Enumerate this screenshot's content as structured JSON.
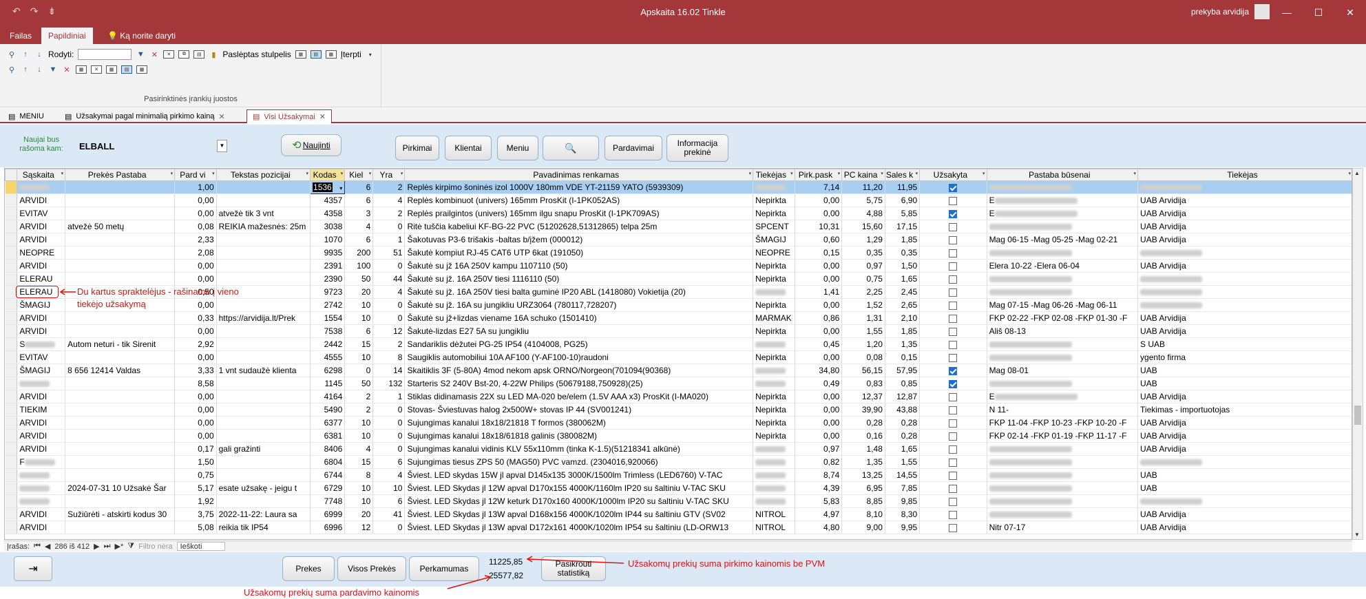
{
  "window": {
    "title": "Apskaita 16.02 Tinkle",
    "user": "prekyba arvidija",
    "controls": [
      "—",
      "☐",
      "✕"
    ]
  },
  "quick_access": [
    "↶",
    "↷",
    "⇟"
  ],
  "ribbon": {
    "tabs": [
      "Failas",
      "Papildiniai"
    ],
    "tell_me": "Ką norite daryti",
    "rodyti_label": "Rodyti:",
    "hidden_column_label": "Paslėptas stulpelis",
    "insert_label": "Įterpti",
    "group_label": "Pasirinktinės įrankių juostos"
  },
  "doc_tabs": [
    {
      "label": "MENIU"
    },
    {
      "label": "Užsakymai pagal minimalią pirkimo kainą"
    },
    {
      "label": "Visi Užsakymai"
    }
  ],
  "form": {
    "naujai_label": "Naujai bus rašoma kam:",
    "supplier": "ELBALL",
    "buttons": {
      "refresh": "Naujinti",
      "pirkimai": "Pirkimai",
      "klientai": "Klientai",
      "meniu": "Meniu",
      "pardavimai": "Pardavimai",
      "info_line1": "Informacija",
      "info_line2": "prekinė"
    }
  },
  "grid": {
    "columns": [
      "Sąskaita",
      "Prekės Pastaba",
      "Pard vi",
      "Tekstas pozicijai",
      "Kodas",
      "Kiel",
      "Yra",
      "Pavadinimas renkamas",
      "Tiekėjas",
      "Pirk.pask",
      "PC kaina",
      "Sales k",
      "Užsakyta",
      "Pastaba būsenai",
      "Tiekėjas"
    ],
    "rows": [
      [
        "",
        "",
        "1,00",
        "",
        "1536",
        "6",
        "2",
        "Replės kirpimo šoninės izol 1000V 180mm VDE YT-21159 YATO (5939309)",
        "",
        "7,14",
        "11,20",
        "11,95",
        true,
        "",
        ""
      ],
      [
        "ARVIDI",
        "",
        "0,00",
        "",
        "4357",
        "6",
        "4",
        "Replės kombinuot (univers) 165mm ProsKit (I-1PK052AS)",
        "Nepirkta",
        "0,00",
        "5,75",
        "6,90",
        false,
        "E",
        "UAB Arvidija"
      ],
      [
        "EVITAV",
        "",
        "0,00",
        "atvežė tik 3 vnt",
        "4358",
        "3",
        "2",
        "Replės prailgintos (univers) 165mm ilgu snapu ProsKit (I-1PK709AS)",
        "Nepirkta",
        "0,00",
        "4,88",
        "5,85",
        true,
        "E",
        "UAB Arvidija"
      ],
      [
        "ARVIDI",
        "atvežė 50 metų",
        "0,08",
        "REIKIA mažesnės: 25m",
        "3038",
        "4",
        "0",
        "Ritė tuščia kabeliui KF-BG-22 PVC (51202628,51312865) telpa 25m",
        "SPCENT",
        "10,31",
        "15,60",
        "17,15",
        false,
        "",
        "UAB Arvidija"
      ],
      [
        "ARVIDI",
        "",
        "2,33",
        "",
        "1070",
        "6",
        "1",
        "Šakotuvas P3-6 trišakis -baltas b/įžem (000012)",
        "ŠMAGIJ",
        "0,60",
        "1,29",
        "1,85",
        false,
        "Mag 06-15 -Mag 05-25 -Mag 02-21",
        "UAB Arvidija"
      ],
      [
        "NEOPRE",
        "",
        "2,08",
        "",
        "9935",
        "200",
        "51",
        "Šakutė kompiut  RJ-45 CAT6  UTP 6kat (191050)",
        "NEOPRE",
        "0,15",
        "0,35",
        "0,35",
        false,
        "",
        ""
      ],
      [
        "ARVIDI",
        "",
        "0,00",
        "",
        "2391",
        "100",
        "0",
        "Šakutė su jž 16A 250V kampu  1107110 (50)",
        "Nepirkta",
        "0,00",
        "0,97",
        "1,50",
        false,
        "Elera 10-22 -Elera 06-04",
        "UAB Arvidija"
      ],
      [
        "ELERAU",
        "",
        "0,00",
        "",
        "2390",
        "50",
        "44",
        "Šakutė su jž. 16A 250V tiesi  1116110 (50)",
        "Nepirkta",
        "0,00",
        "0,75",
        "1,65",
        false,
        "",
        ""
      ],
      [
        "ELERAU",
        "",
        "0,50",
        "",
        "9723",
        "20",
        "4",
        "Šakutė su jž. 16A 250V tiesi balta guminė IP20 ABL (1418080) Vokietija (20)",
        "",
        "1,41",
        "2,25",
        "2,45",
        false,
        "",
        ""
      ],
      [
        "ŠMAGIJ",
        "",
        "0,00",
        "",
        "2742",
        "10",
        "0",
        "Šakutė su jž. 16A su jungikliu URZ3064 (780117,728207)",
        "Nepirkta",
        "0,00",
        "1,52",
        "2,65",
        false,
        "Mag 07-15 -Mag 06-26 -Mag 06-11",
        ""
      ],
      [
        "ARVIDI",
        "",
        "0,33",
        "https://arvidija.lt/Prek",
        "1554",
        "10",
        "0",
        "Šakutė su jž+lizdas  viename 16A schuko (1501410)",
        "MARMAK",
        "0,86",
        "1,31",
        "2,10",
        false,
        "FKP 02-22 -FKP 02-08 -FKP 01-30 -F",
        "UAB Arvidija"
      ],
      [
        "ARVIDI",
        "",
        "0,00",
        "",
        "7538",
        "6",
        "12",
        "Šakutė-lizdas E27 5A su jungikliu",
        "Nepirkta",
        "0,00",
        "1,55",
        "1,85",
        false,
        "Ališ 08-13",
        "UAB Arvidija"
      ],
      [
        "S",
        "Autom neturi - tik Sirenit",
        "2,92",
        "",
        "2442",
        "15",
        "2",
        "Sandariklis dėžutei PG-25 IP54 (4104008, PG25)",
        "",
        "0,45",
        "1,20",
        "1,35",
        false,
        "",
        "S UAB"
      ],
      [
        "EVITAV",
        "",
        "0,00",
        "",
        "4555",
        "10",
        "8",
        "Saugiklis automobiliui 10A AF100 (Y-AF100-10)raudoni",
        "Nepirkta",
        "0,00",
        "0,08",
        "0,15",
        false,
        "",
        "ygento firma"
      ],
      [
        "ŠMAGIJ",
        "8 656 12414 Valdas",
        "3,33",
        "1 vnt sudaužė klienta",
        "6298",
        "0",
        "14",
        "Skaitiklis 3F (5-80A) 4mod nekom apsk ORNO/Norgeon(701094(90368)",
        "",
        "34,80",
        "56,15",
        "57,95",
        true,
        "Mag 08-01",
        "UAB"
      ],
      [
        "",
        "",
        "8,58",
        "",
        "1145",
        "50",
        "132",
        "Starteris S2 240V Bst-20, 4-22W Philips (50679188,750928)(25)",
        "",
        "0,49",
        "0,83",
        "0,85",
        true,
        "",
        "UAB"
      ],
      [
        "ARVIDI",
        "",
        "0,00",
        "",
        "4164",
        "2",
        "1",
        "Stiklas didinamasis 22X su LED MA-020 be/elem (1.5V AAA x3) ProsKit (I-MA020)",
        "Nepirkta",
        "0,00",
        "12,37",
        "12,87",
        false,
        "E",
        "UAB Arvidija"
      ],
      [
        "TIEKIM",
        "",
        "0,00",
        "",
        "5490",
        "2",
        "0",
        "Stovas- Šviestuvas halog 2x500W+ stovas IP 44 (SV001241)",
        "Nepirkta",
        "0,00",
        "39,90",
        "43,88",
        false,
        "N 11-",
        "Tiekimas - importuotojas"
      ],
      [
        "ARVIDI",
        "",
        "0,00",
        "",
        "6377",
        "10",
        "0",
        "Sujungimas kanalui 18x18/21818 T formos (380062M)",
        "Nepirkta",
        "0,00",
        "0,28",
        "0,28",
        false,
        "FKP 11-04 -FKP 10-23 -FKP 10-20 -F",
        "UAB Arvidija"
      ],
      [
        "ARVIDI",
        "",
        "0,00",
        "",
        "6381",
        "10",
        "0",
        "Sujungimas kanalui 18x18/61818 galinis (380082M)",
        "Nepirkta",
        "0,00",
        "0,16",
        "0,28",
        false,
        "FKP 02-14 -FKP 01-19 -FKP 11-17 -F",
        "UAB Arvidija"
      ],
      [
        "ARVIDI",
        "",
        "0,17",
        "gali gražinti",
        "8406",
        "4",
        "0",
        "Sujungimas kanalui vidinis KLV 55x110mm (tinka K-1.5)(51218341 alkūnė)",
        "",
        "0,97",
        "1,48",
        "1,65",
        false,
        "",
        "UAB Arvidija"
      ],
      [
        "F",
        "",
        "1,50",
        "",
        "6804",
        "15",
        "6",
        "Sujungimas tiesus ZPS 50 (MAG50) PVC vamzd. (2304016,920066)",
        "",
        "0,82",
        "1,35",
        "1,55",
        false,
        "",
        ""
      ],
      [
        "",
        "",
        "0,75",
        "",
        "6744",
        "8",
        "4",
        "Šviest. LED skydas 15W jl apval D145x135 3000K/1500lm Trimless (LED6760) V-TAC",
        "",
        "8,74",
        "13,25",
        "14,55",
        false,
        "",
        "UAB"
      ],
      [
        "",
        "2024-07-31 10 Užsakė Šar",
        "5,17",
        "esate užsakę - jeigu t",
        "6729",
        "10",
        "10",
        "Šviest. LED Skydas jl 12W apval D170x155 4000K/1160lm IP20 su šaltiniu V-TAC SKU",
        "",
        "4,39",
        "6,95",
        "7,85",
        false,
        "",
        "UAB"
      ],
      [
        "",
        "",
        "1,92",
        "",
        "7748",
        "10",
        "6",
        "Šviest. LED Skydas jl 12W keturk D170x160 4000K/1000lm IP20 su šaltiniu V-TAC SKU",
        "",
        "5,83",
        "8,85",
        "9,85",
        false,
        "",
        ""
      ],
      [
        "ARVIDI",
        "Sužiūrėti - atskirti kodus 30",
        "3,75",
        "2022-11-22: Laura sa",
        "6999",
        "20",
        "41",
        "Šviest. LED Skydas jl 13W apval D168x156 4000K/1020lm IP44 su šaltiniu  GTV (SV02",
        "NITROL",
        "4,97",
        "8,10",
        "8,30",
        false,
        "",
        "UAB Arvidija"
      ],
      [
        "ARVIDI",
        "",
        "5,08",
        "reikia tik IP54",
        "6996",
        "12",
        "0",
        "Šviest. LED Skydas jl 13W apval D172x161 4000K/1020lm IP54 su šaltiniu (LD-ORW13",
        "NITROL",
        "4,80",
        "9,00",
        "9,95",
        false,
        "Nitr 07-17",
        "UAB Arvidija"
      ]
    ]
  },
  "navbar": {
    "label": "Įrašas:",
    "position": "286 iš 412",
    "filter": "Filtro nėra",
    "search": "Ieškoti"
  },
  "footer": {
    "buttons": {
      "prekes": "Prekes",
      "visos_prekes": "Visos Prekės",
      "perkamumas": "Perkamumas",
      "stat_line1": "Pasikrouti",
      "stat_line2": "statistiką"
    },
    "sum_purchase": "11225,85",
    "sum_sales": "25577,82"
  },
  "annotations": {
    "duplicate_note_line1": "Du kartus spraktelėjus - rašiname į vieno",
    "duplicate_note_line2": "tiekėjo užsakymą",
    "purchase_sum_note": "Užsakomų prekių suma pirkimo kainomis be PVM",
    "sales_sum_note": "Užsakomų prekių suma pardavimo kainomis"
  },
  "colors": {
    "titlebar": "#a4373a",
    "form_bg": "#dbe9f6",
    "selected_row": "#a8cff2",
    "annotation": "#dd1111"
  }
}
